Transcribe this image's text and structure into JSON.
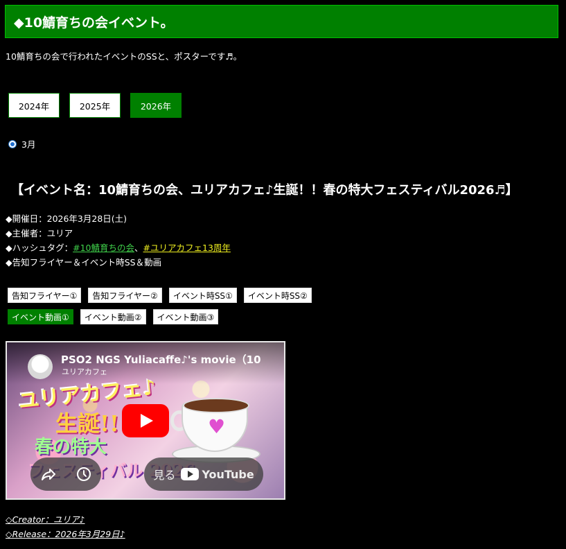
{
  "header": {
    "title": "◆10鯖育ちの会イベント。"
  },
  "intro": "10鯖育ちの会で行われたイベントのSSと、ポスターです♬。",
  "years": [
    {
      "label": "2024年",
      "active": false
    },
    {
      "label": "2025年",
      "active": false
    },
    {
      "label": "2026年",
      "active": true
    }
  ],
  "month": {
    "label": "3月",
    "checked": true
  },
  "event": {
    "title": "【イベント名：10鯖育ちの会、ユリアカフェ♪生誕！！春の特大フェスティバル2026♬】",
    "date": "◆開催日：2026年3月28日(土)",
    "organizer": "◆主催者：ユリア",
    "hashtag_prefix": "◆ハッシュタグ：",
    "hashtag1": "#10鯖育ちの会",
    "hashtag_sep": "、",
    "hashtag2": "#ユリアカフェ13周年",
    "media_note": "◆告知フライヤー＆イベント時SS＆動画"
  },
  "buttons_row1": [
    "告知フライヤー①",
    "告知フライヤー②",
    "イベント時SS①",
    "イベント時SS②"
  ],
  "buttons_row2": [
    "イベント動画①",
    "イベント動画②",
    "イベント動画③"
  ],
  "active_button": "イベント動画①",
  "video": {
    "title": "PSO2 NGS Yuliacaffe♪'s movie（10",
    "channel": "ユリアカフェ",
    "art_line1": "ユリアカフェ♪",
    "art_line2": "生誕!!",
    "art_line3": "春の特大",
    "art_line4": "フェスティバル 2026",
    "watch_label": "見る",
    "youtube_label": "YouTube",
    "icons": [
      "share-icon",
      "clock-icon",
      "play-icon",
      "youtube-logo-icon"
    ]
  },
  "credits": {
    "creator": "◇Creator：ユリア♪",
    "release": "◇Release：2026年3月29日♪"
  },
  "colors": {
    "accent_green": "#008000",
    "hashtag_green": "#3fd04a",
    "hashtag_yellow": "#f0f020",
    "background": "#000000"
  }
}
